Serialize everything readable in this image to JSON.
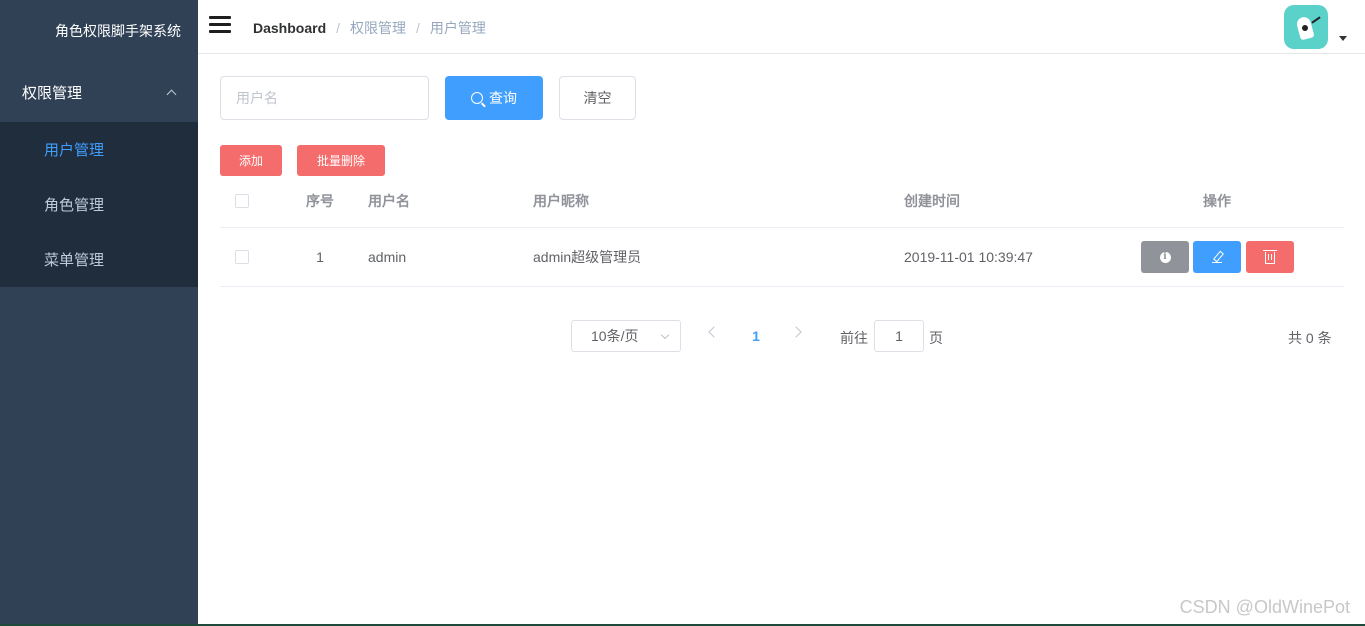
{
  "app": {
    "title": "角色权限脚手架系统"
  },
  "sidebar": {
    "group": {
      "label": "权限管理"
    },
    "items": [
      {
        "label": "用户管理",
        "active": true
      },
      {
        "label": "角色管理",
        "active": false
      },
      {
        "label": "菜单管理",
        "active": false
      }
    ]
  },
  "header": {
    "breadcrumb": {
      "home": "Dashboard",
      "sep": "/",
      "level1": "权限管理",
      "level2": "用户管理"
    }
  },
  "search": {
    "placeholder": "用户名",
    "value": "",
    "query_label": "查询",
    "clear_label": "清空"
  },
  "actions": {
    "add_label": "添加",
    "batch_delete_label": "批量删除"
  },
  "table": {
    "headers": {
      "index": "序号",
      "username": "用户名",
      "nickname": "用户昵称",
      "created": "创建时间",
      "ops": "操作"
    },
    "rows": [
      {
        "index": "1",
        "username": "admin",
        "nickname": "admin超级管理员",
        "created": "2019-11-01 10:39:47"
      }
    ]
  },
  "pagination": {
    "page_size": "10条/页",
    "current_page": "1",
    "goto_prefix": "前往",
    "goto_value": "1",
    "goto_suffix": "页",
    "total": "共 0 条"
  },
  "watermark": "CSDN @OldWinePot",
  "colors": {
    "sidebar_bg": "#304156",
    "submenu_bg": "#1f2d3d",
    "primary": "#409eff",
    "danger": "#f56c6c",
    "info": "#909399"
  }
}
